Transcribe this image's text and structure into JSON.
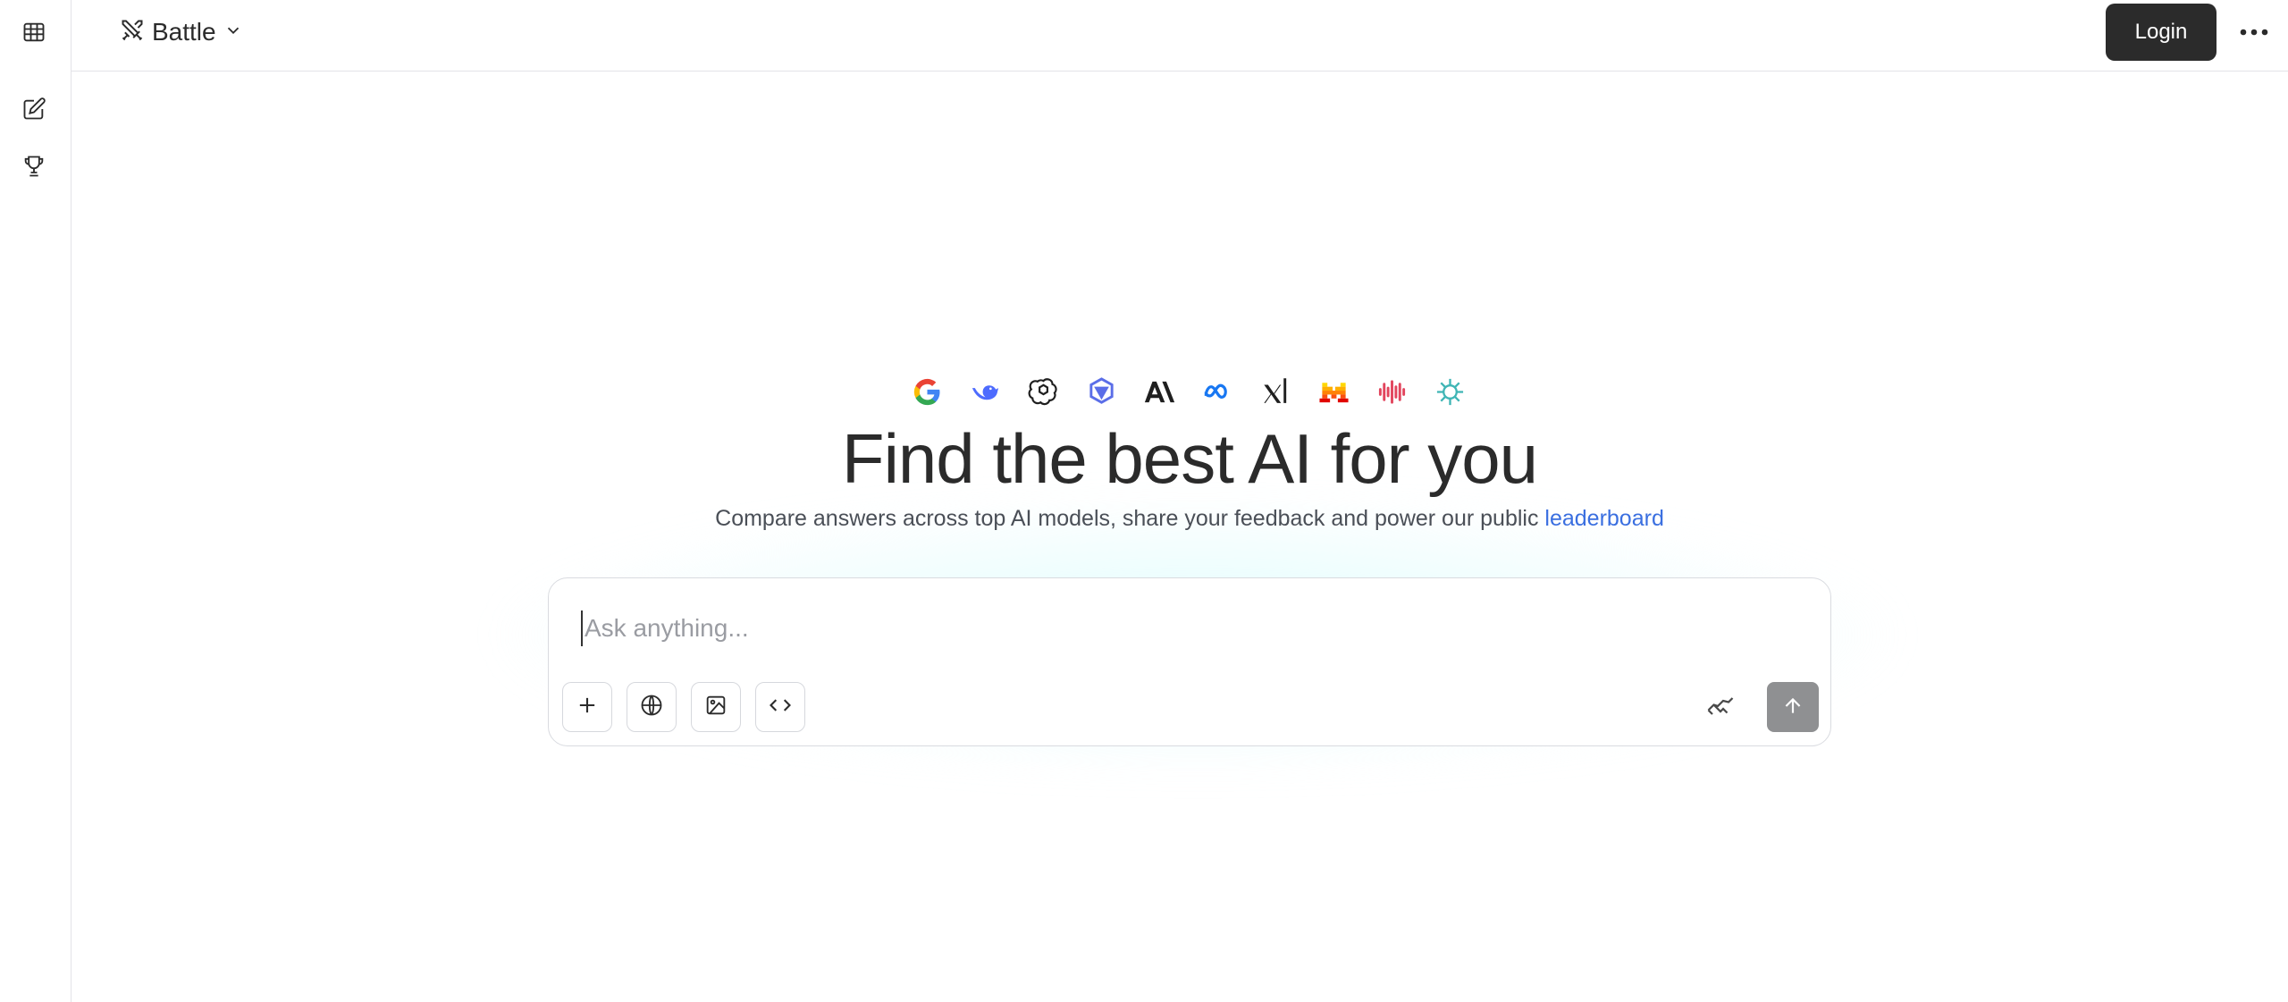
{
  "header": {
    "mode_label": "Battle",
    "login_label": "Login"
  },
  "hero": {
    "title": "Find the best AI for you",
    "subtitle_prefix": "Compare answers across top AI models, share your feedback and power our public ",
    "subtitle_link": "leaderboard",
    "logos": [
      "google-icon",
      "deepseek-icon",
      "openai-icon",
      "qwen-icon",
      "anthropic-icon",
      "meta-icon",
      "xai-icon",
      "mistral-icon",
      "minimax-icon",
      "zhipu-icon"
    ]
  },
  "composer": {
    "placeholder": "Ask anything..."
  },
  "colors": {
    "accent_link": "#3a6fe0",
    "login_bg": "#2b2b2b",
    "send_bg": "#8f9092"
  }
}
